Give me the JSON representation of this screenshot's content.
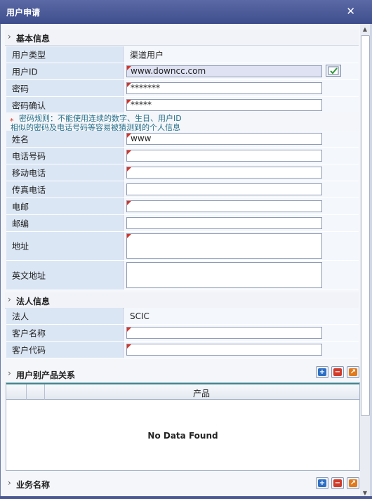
{
  "window": {
    "title": "用户申请",
    "close_icon": "close-icon"
  },
  "sections": {
    "basic": "基本信息",
    "legal": "法人信息",
    "product_rel": "用户别产品关系",
    "business": "业务名称"
  },
  "fields": {
    "user_type": {
      "label": "用户类型",
      "value": "渠道用户"
    },
    "user_id": {
      "label": "用户ID",
      "value": "www.downcc.com"
    },
    "password": {
      "label": "密码",
      "value": "*******"
    },
    "password_confirm": {
      "label": "密码确认",
      "value": "*****"
    },
    "name": {
      "label": "姓名",
      "value": "www"
    },
    "phone": {
      "label": "电话号码",
      "value": ""
    },
    "mobile": {
      "label": "移动电话",
      "value": ""
    },
    "fax": {
      "label": "传真电话",
      "value": ""
    },
    "email": {
      "label": "电邮",
      "value": ""
    },
    "zip": {
      "label": "邮编",
      "value": ""
    },
    "address": {
      "label": "地址",
      "value": ""
    },
    "en_address": {
      "label": "英文地址",
      "value": ""
    },
    "legal_person": {
      "label": "法人",
      "value": "SCIC"
    },
    "customer_name": {
      "label": "客户名称",
      "value": ""
    },
    "customer_code": {
      "label": "客户代码",
      "value": ""
    }
  },
  "password_hint": {
    "star": "*",
    "line1": "密码规则：不能使用连续的数字、生日、用户ID",
    "line2": "相似的密码及电话号码等容易被猜测到的个人信息"
  },
  "grid": {
    "column": "产品",
    "empty_text": "No Data Found"
  },
  "colors": {
    "required_marker": "#e03020",
    "title_bar": "#3e4d8c",
    "label_bg": "#dbe6f4"
  }
}
